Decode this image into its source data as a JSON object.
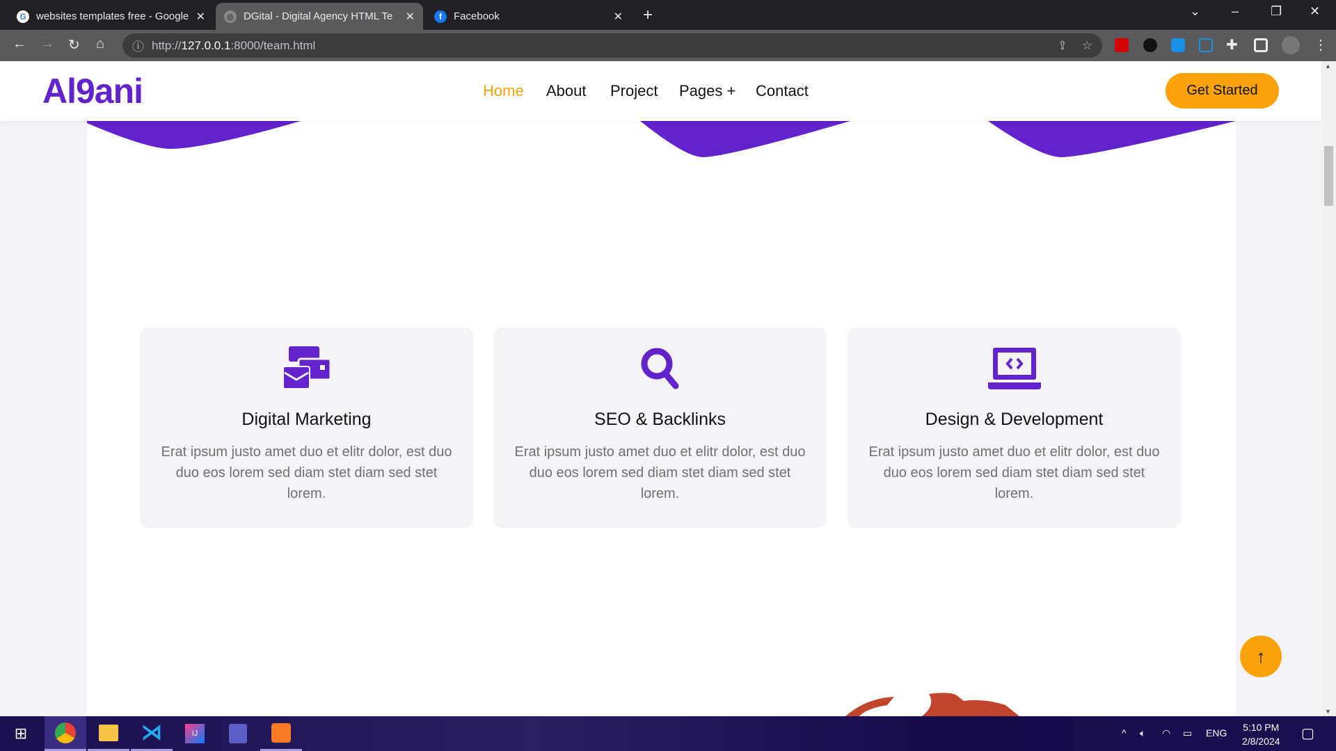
{
  "browser": {
    "tabs": [
      {
        "title": "websites templates free - Google",
        "icon": "google-icon",
        "active": false
      },
      {
        "title": "DGital - Digital Agency HTML Template",
        "icon": "globe-icon",
        "active": true
      },
      {
        "title": "Facebook",
        "icon": "facebook-icon",
        "active": false
      }
    ],
    "url_scheme": "http://",
    "url_host": "127.0.0.1",
    "url_rest": ":8000/team.html"
  },
  "site": {
    "logo": "Al9ani",
    "menu": [
      "Home",
      "About",
      "Project",
      "Pages +",
      "Contact"
    ],
    "cta": "Get Started",
    "colors": {
      "primary": "#6222cc",
      "accent": "#f9a20a"
    }
  },
  "services": [
    {
      "icon": "envelope-cards-icon",
      "title": "Digital Marketing",
      "text": "Erat ipsum justo amet duo et elitr dolor, est duo duo eos lorem sed diam stet diam sed stet lorem."
    },
    {
      "icon": "search-icon",
      "title": "SEO & Backlinks",
      "text": "Erat ipsum justo amet duo et elitr dolor, est duo duo eos lorem sed diam stet diam sed stet lorem."
    },
    {
      "icon": "laptop-code-icon",
      "title": "Design & Development",
      "text": "Erat ipsum justo amet duo et elitr dolor, est duo duo eos lorem sed diam stet diam sed stet lorem."
    }
  ],
  "back_to_top": "↑",
  "taskbar": {
    "time": "5:10 PM",
    "date": "2/8/2024",
    "lang": "ENG"
  }
}
